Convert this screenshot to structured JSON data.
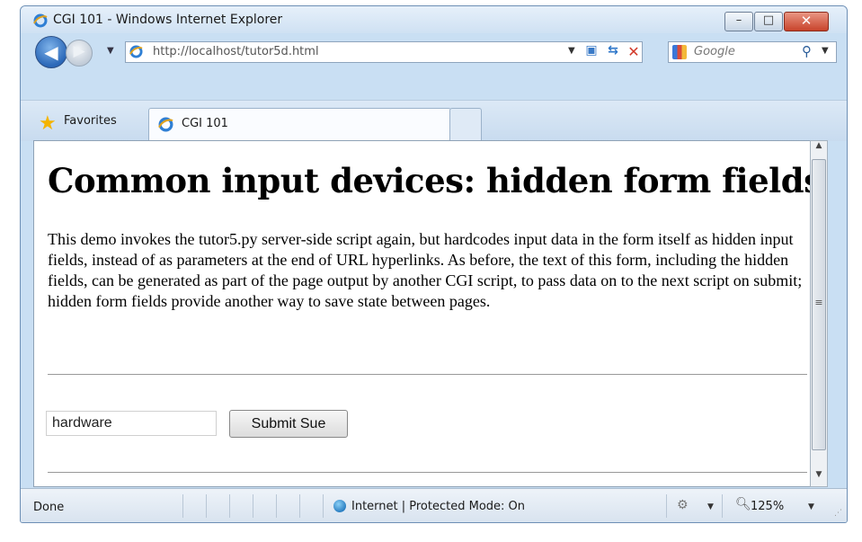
{
  "window": {
    "title": "CGI 101 - Windows Internet Explorer",
    "controls": {
      "minimize": "–",
      "maximize": "□",
      "close": "✕"
    }
  },
  "navigation": {
    "back_glyph": "◀",
    "forward_glyph": "▶",
    "address": "http://localhost/tutor5d.html",
    "search_placeholder": "Google"
  },
  "favorites": {
    "label": "Favorites"
  },
  "tabs": [
    {
      "label": "CGI 101"
    }
  ],
  "page": {
    "heading": "Common input devices: hidden form fields",
    "paragraph": "This demo invokes the tutor5.py server-side script again, but hardcodes input data in the form itself as hidden input fields, instead of as parameters at the end of URL hyperlinks. As before, the text of this form, including the hidden fields, can be generated as part of the page output by another CGI script, to pass data on to the next script on submit; hidden form fields provide another way to save state between pages.",
    "form": {
      "input_value": "hardware",
      "submit_label": "Submit Sue"
    }
  },
  "status": {
    "text": "Done",
    "zone": "Internet | Protected Mode: On",
    "zoom": "125%"
  },
  "icons": {
    "ie": "ie-logo-icon",
    "favorites": "star-icon",
    "search_provider": "google-icon",
    "search": "magnifier-icon",
    "zone": "globe-icon",
    "zoom": "zoom-icon"
  },
  "colors": {
    "chrome": "#c9dff3",
    "close_button": "#c8432b",
    "tab_active": "#fafcff"
  }
}
